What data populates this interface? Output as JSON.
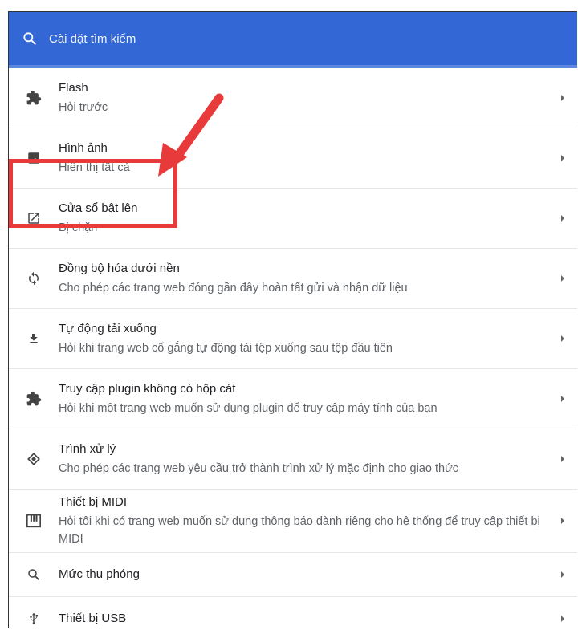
{
  "search": {
    "placeholder": "Cài đặt tìm kiếm"
  },
  "colors": {
    "header": "#3367d6",
    "highlight": "#e83a3a"
  },
  "items": [
    {
      "icon": "puzzle-icon",
      "title": "Flash",
      "subtitle": "Hỏi trước"
    },
    {
      "icon": "image-icon",
      "title": "Hình ảnh",
      "subtitle": "Hiển thị tất cả"
    },
    {
      "icon": "popup-icon",
      "title": "Cửa sổ bật lên",
      "subtitle": "Bị chặn"
    },
    {
      "icon": "sync-icon",
      "title": "Đồng bộ hóa dưới nền",
      "subtitle": "Cho phép các trang web đóng gần đây hoàn tất gửi và nhận dữ liệu"
    },
    {
      "icon": "download-icon",
      "title": "Tự động tải xuống",
      "subtitle": "Hỏi khi trang web cố gắng tự động tải tệp xuống sau tệp đầu tiên"
    },
    {
      "icon": "puzzle-icon",
      "title": "Truy cập plugin không có hộp cát",
      "subtitle": "Hỏi khi một trang web muốn sử dụng plugin để truy cập máy tính của bạn"
    },
    {
      "icon": "handler-icon",
      "title": "Trình xử lý",
      "subtitle": "Cho phép các trang web yêu cầu trở thành trình xử lý mặc định cho giao thức"
    },
    {
      "icon": "midi-icon",
      "title": "Thiết bị MIDI",
      "subtitle": "Hỏi tôi khi có trang web muốn sử dụng thông báo dành riêng cho hệ thống để truy cập thiết bị MIDI"
    },
    {
      "icon": "zoom-icon",
      "title": "Mức thu phóng",
      "subtitle": ""
    },
    {
      "icon": "usb-icon",
      "title": "Thiết bị USB",
      "subtitle": ""
    }
  ]
}
